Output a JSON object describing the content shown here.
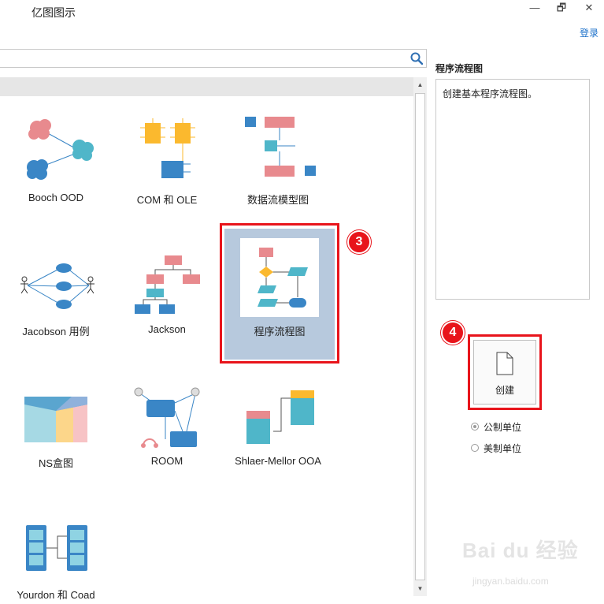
{
  "app": {
    "title": "亿图图示",
    "login": "登录"
  },
  "window_controls": {
    "minimize": "—",
    "restore": "🗗",
    "close": "✕"
  },
  "icons": {
    "search": "search-icon"
  },
  "templates": [
    {
      "label": "Booch OOD"
    },
    {
      "label": "COM 和 OLE"
    },
    {
      "label": "数据流模型图"
    },
    {
      "label": "Jacobson 用例"
    },
    {
      "label": "Jackson"
    },
    {
      "label": "程序流程图",
      "selected": true
    },
    {
      "label": "NS盒图"
    },
    {
      "label": "ROOM"
    },
    {
      "label": "Shlaer-Mellor OOA"
    },
    {
      "label": "Yourdon 和 Coad"
    }
  ],
  "annotations": {
    "step3": "3",
    "step4": "4"
  },
  "description": {
    "title": "程序流程图",
    "text": "创建基本程序流程图。"
  },
  "create": {
    "label": "创建"
  },
  "units": [
    {
      "label": "公制单位",
      "checked": true
    },
    {
      "label": "美制单位",
      "checked": false
    }
  ],
  "watermark": {
    "brand": "Bai du 经验",
    "url": "jingyan.baidu.com"
  },
  "colors": {
    "accent_red": "#e8141b",
    "pink": "#e88a8e",
    "teal": "#4fb6c9",
    "blue": "#3a86c6",
    "yellow": "#fbb92e",
    "selected_bg": "#b7c9dd",
    "link": "#1a6fc9"
  }
}
